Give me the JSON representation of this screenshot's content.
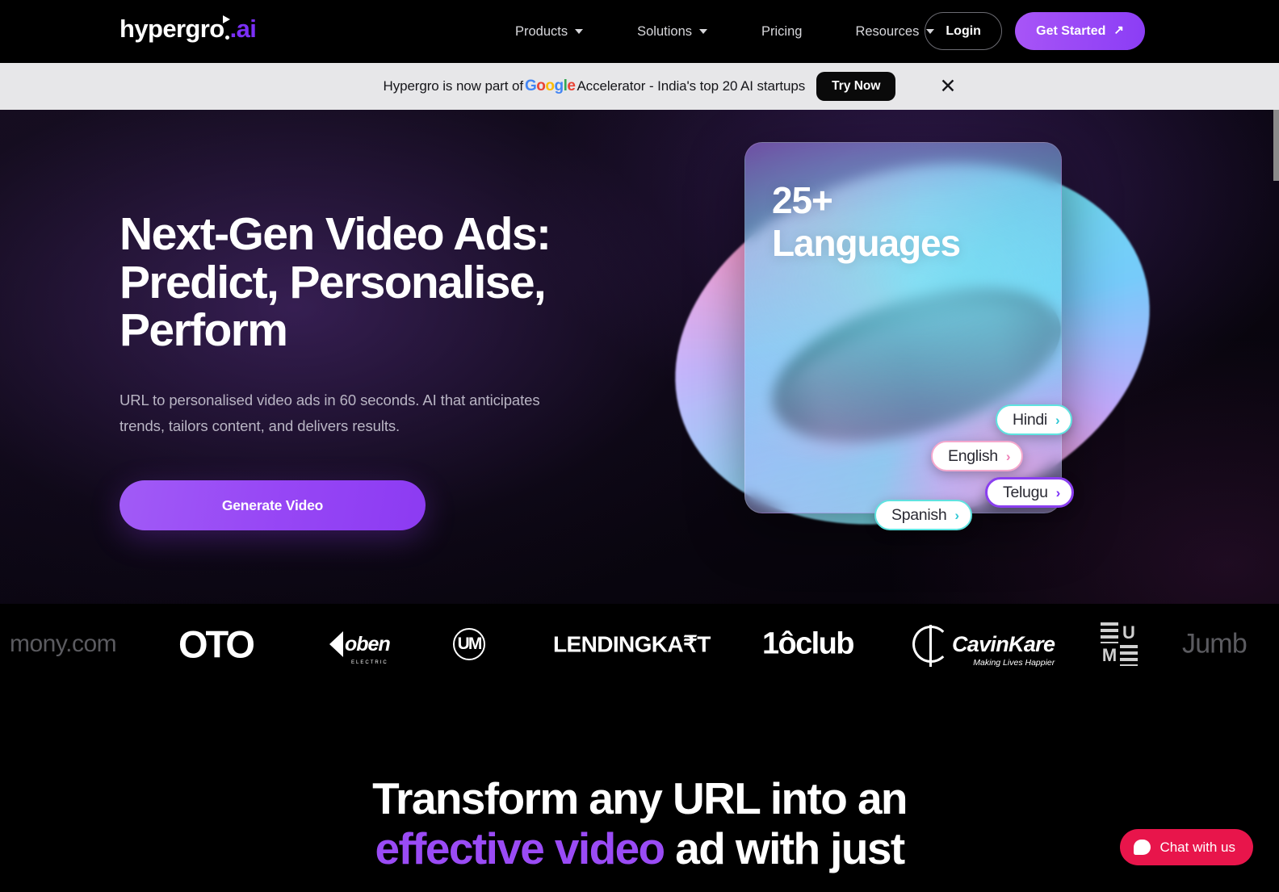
{
  "header": {
    "logo": {
      "name": "hypergro",
      "suffix": ".ai"
    },
    "nav": [
      {
        "label": "Products",
        "has_dropdown": true
      },
      {
        "label": "Solutions",
        "has_dropdown": true
      },
      {
        "label": "Pricing",
        "has_dropdown": false
      },
      {
        "label": "Resources",
        "has_dropdown": true
      }
    ],
    "login_label": "Login",
    "get_started_label": "Get Started",
    "get_started_icon": "arrow-up-right-icon"
  },
  "banner": {
    "text_before": "Hypergro is now part of ",
    "google": [
      "G",
      "o",
      "o",
      "g",
      "l",
      "e"
    ],
    "text_after": " Accelerator - India's top 20 AI startups",
    "cta_label": "Try Now",
    "close_icon": "close-icon"
  },
  "hero": {
    "heading_line1": "Next-Gen Video Ads:",
    "heading_line2": "Predict, Personalise,",
    "heading_line3": "Perform",
    "subtitle": "URL to personalised video ads in 60 seconds. AI that anticipates trends, tailors content, and delivers results.",
    "cta_label": "Generate Video",
    "card": {
      "count": "25+",
      "label": "Languages",
      "pills": [
        {
          "label": "Hindi",
          "chevron": "›",
          "color": "#5FE3E0"
        },
        {
          "label": "English",
          "chevron": "›",
          "color": "#F4A8CD"
        },
        {
          "label": "Telugu",
          "chevron": "›",
          "color": "#8A3FF0"
        },
        {
          "label": "Spanish",
          "chevron": "›",
          "color": "#5FE3E0"
        }
      ]
    }
  },
  "logo_strip": {
    "logos": [
      {
        "name": "mony.com",
        "text": "mony.com"
      },
      {
        "name": "OTO",
        "text": "OTO"
      },
      {
        "name": "oben electric",
        "text": "oben",
        "sub": "ELECTRIC"
      },
      {
        "name": "UM",
        "text": "UM"
      },
      {
        "name": "Lendingkart",
        "text": "LENDINGKA₹T"
      },
      {
        "name": "10club",
        "text": "1ôclub"
      },
      {
        "name": "CavinKare",
        "text": "CavinKare",
        "sub": "Making Lives Happier"
      },
      {
        "name": "EUME",
        "text": "EUME"
      },
      {
        "name": "Jumbotail",
        "text": "Jumb"
      }
    ]
  },
  "section2": {
    "line1": "Transform any URL into an",
    "line2_accent": "effective video",
    "line2_rest": " ad with just"
  },
  "chat": {
    "label": "Chat with us",
    "icon": "chat-bubble-icon"
  },
  "colors": {
    "accent_purple": "#9A4BF5",
    "brand_purple": "#7B2FF7",
    "chat_red": "#E8154B",
    "banner_bg": "#E7E7E9"
  }
}
